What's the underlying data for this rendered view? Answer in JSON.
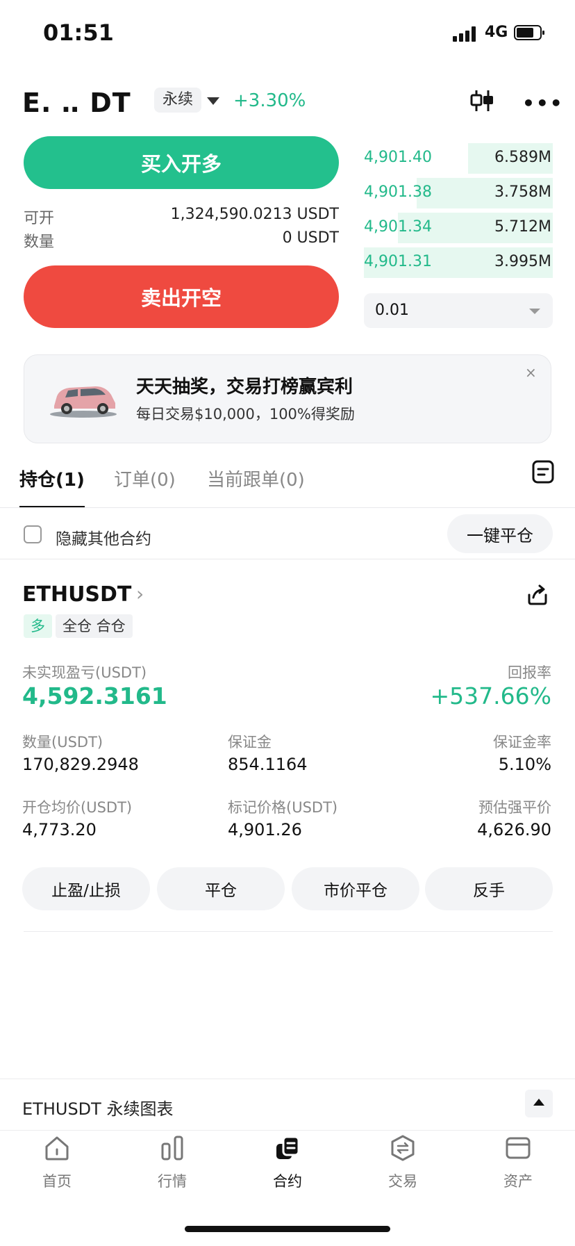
{
  "status_bar": {
    "time": "01:51",
    "network": "4G"
  },
  "header": {
    "pair": "E. ‥ DT",
    "contract_type": "永续",
    "change": "+3.30%"
  },
  "trade": {
    "buy_label": "买入开多",
    "sell_label": "卖出开空",
    "available_label": "可开",
    "available_value": "1,324,590.0213 USDT",
    "quantity_label": "数量",
    "quantity_value": "0 USDT"
  },
  "orderbook": {
    "rows": [
      {
        "price": "4,901.40",
        "qty": "6.589M",
        "depth": 0.45
      },
      {
        "price": "4,901.38",
        "qty": "3.758M",
        "depth": 0.72
      },
      {
        "price": "4,901.34",
        "qty": "5.712M",
        "depth": 0.82
      },
      {
        "price": "4,901.31",
        "qty": "3.995M",
        "depth": 1.0
      }
    ],
    "precision": "0.01"
  },
  "banner": {
    "title": "天天抽奖，交易打榜赢宾利",
    "subtitle": "每日交易$10,000，100%得奖励",
    "close": "×"
  },
  "tabs": [
    "持仓(1)",
    "订单(0)",
    "当前跟单(0)"
  ],
  "filter": {
    "hide_label": "隐藏其他合约",
    "close_all": "一键平仓"
  },
  "position": {
    "symbol": "ETHUSDT",
    "chevron": "›",
    "side_tag": "多",
    "margin_tag": "全仓 合仓",
    "pnl_label": "未实现盈亏(USDT)",
    "pnl_value": "4,592.3161",
    "roe_label": "回报率",
    "roe_value": "+537.66%",
    "qty_label": "数量(USDT)",
    "qty_value": "170,829.2948",
    "margin_label": "保证金",
    "margin_value": "854.1164",
    "margin_rate_label": "保证金率",
    "margin_rate_value": "5.10%",
    "entry_label": "开仓均价(USDT)",
    "entry_value": "4,773.20",
    "mark_label": "标记价格(USDT)",
    "mark_value": "4,901.26",
    "liq_label": "预估强平价",
    "liq_value": "4,626.90",
    "actions": [
      "止盈/止损",
      "平仓",
      "市价平仓",
      "反手"
    ]
  },
  "chart_bar": {
    "label": "ETHUSDT 永续图表"
  },
  "tabbar": [
    {
      "label": "首页",
      "icon": "home-icon"
    },
    {
      "label": "行情",
      "icon": "market-icon"
    },
    {
      "label": "合约",
      "icon": "contract-icon"
    },
    {
      "label": "交易",
      "icon": "trade-icon"
    },
    {
      "label": "资产",
      "icon": "wallet-icon"
    }
  ],
  "colors": {
    "green": "#23c08d",
    "red": "#ef4a40",
    "text_gray": "#888888"
  }
}
